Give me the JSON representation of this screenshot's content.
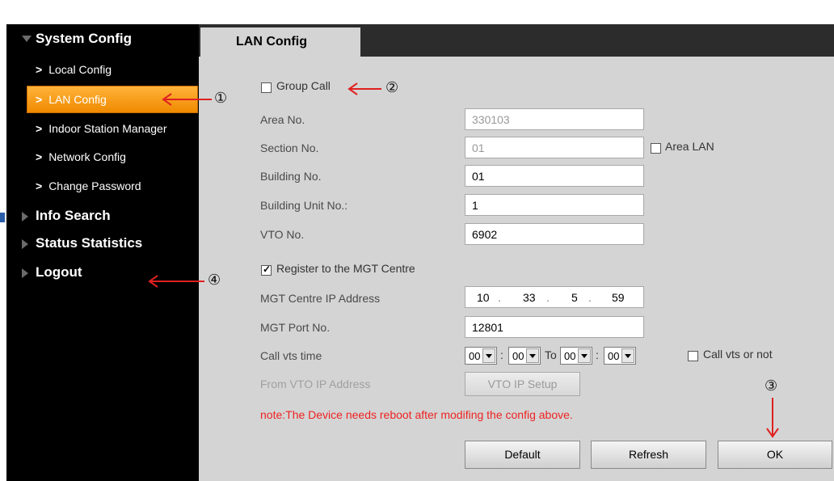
{
  "sidebar": {
    "sections": [
      {
        "label": "System Config"
      },
      {
        "label": "Info Search"
      },
      {
        "label": "Status Statistics"
      },
      {
        "label": "Logout"
      }
    ],
    "items": [
      {
        "label": "Local Config"
      },
      {
        "label": "LAN Config"
      },
      {
        "label": "Indoor Station Manager"
      },
      {
        "label": "Network Config"
      },
      {
        "label": "Change Password"
      }
    ],
    "active_item": "LAN Config"
  },
  "tab": {
    "label": "LAN Config"
  },
  "form": {
    "group_call": {
      "label": "Group Call",
      "checked": false
    },
    "area_no": {
      "label": "Area No.",
      "value": "330103"
    },
    "section_no": {
      "label": "Section No.",
      "value": "01"
    },
    "area_lan": {
      "label": "Area LAN",
      "checked": false
    },
    "building_no": {
      "label": "Building No.",
      "value": "01"
    },
    "building_unit_no": {
      "label": "Building Unit No.:",
      "value": "1"
    },
    "vto_no": {
      "label": "VTO No.",
      "value": "6902"
    },
    "register_mgt": {
      "label": "Register to the MGT Centre",
      "checked": true
    },
    "mgt_ip": {
      "label": "MGT Centre IP Address",
      "parts": [
        "10",
        "33",
        "5",
        "59"
      ],
      "dot": "."
    },
    "mgt_port": {
      "label": "MGT Port No.",
      "value": "12801"
    },
    "call_vts_time": {
      "label": "Call vts time",
      "start_hour": "00",
      "start_min": "00",
      "to_label": "To",
      "end_hour": "00",
      "end_min": "00",
      "colon": ":"
    },
    "call_vts_or_not": {
      "label": "Call vts or not",
      "checked": false
    },
    "from_vto_ip": {
      "label": "From VTO IP Address",
      "button": "VTO IP Setup"
    },
    "note": "note:The Device needs reboot after modifing the config above."
  },
  "buttons": {
    "default": "Default",
    "refresh": "Refresh",
    "ok": "OK"
  },
  "annotations": {
    "one": "①",
    "two": "②",
    "three": "③",
    "four": "④"
  },
  "colors": {
    "active_nav": "#f5a01a",
    "annotation_arrow": "#e02020",
    "note_text": "#ee2222"
  }
}
